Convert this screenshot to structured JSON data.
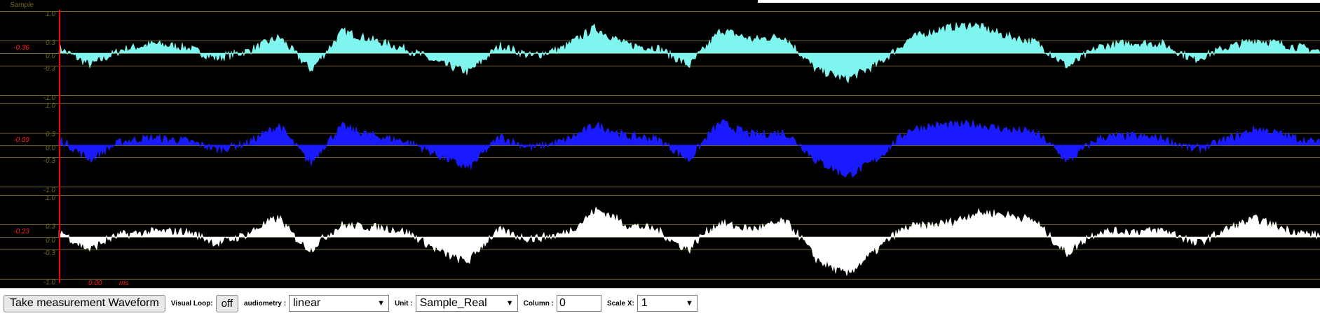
{
  "scope": {
    "header_label": "Sample",
    "time_value": "0.00",
    "time_unit": "ms",
    "tick_labels": [
      "1.0",
      "0.3",
      "0.0",
      "-0.3",
      "-1.0"
    ],
    "tick_values": [
      1.0,
      0.3,
      0.0,
      -0.3,
      -1.0
    ],
    "colors": {
      "background": "#000000",
      "grid": "#6f6a1e",
      "cursor": "#ff0000",
      "channel1": "#7ff5ef",
      "channel2": "#1a1aff",
      "channel3": "#ffffff"
    },
    "channels": [
      {
        "id": "ch1",
        "readout": "-0.36",
        "color": "#7ff5ef"
      },
      {
        "id": "ch2",
        "readout": "-0.09",
        "color": "#1a1aff"
      },
      {
        "id": "ch3",
        "readout": "-0.23",
        "color": "#ffffff"
      }
    ],
    "envelope_profile": [
      0.12,
      -0.28,
      0.08,
      0.22,
      0.14,
      -0.12,
      0.05,
      0.38,
      -0.4,
      0.52,
      0.3,
      0.1,
      -0.22,
      -0.45,
      0.18,
      -0.08,
      0.12,
      0.6,
      0.2,
      0.12,
      -0.3,
      0.55,
      0.32,
      0.4,
      -0.38,
      -0.62,
      -0.25,
      0.35,
      0.58,
      0.68,
      0.42,
      0.25,
      -0.32,
      0.15,
      0.25,
      0.22,
      -0.15,
      0.12,
      0.32,
      0.18,
      0.05
    ]
  },
  "toolbar": {
    "measure_button": "Take measurement Waveform",
    "visual_loop_label": "Visual Loop:",
    "visual_loop_value": "off",
    "audiometry_label": "audiometry :",
    "audiometry_value": "linear",
    "unit_label": "Unit :",
    "unit_value": "Sample_Real",
    "column_label": "Column :",
    "column_value": "0",
    "scale_label": "Scale X:",
    "scale_value": "1"
  }
}
